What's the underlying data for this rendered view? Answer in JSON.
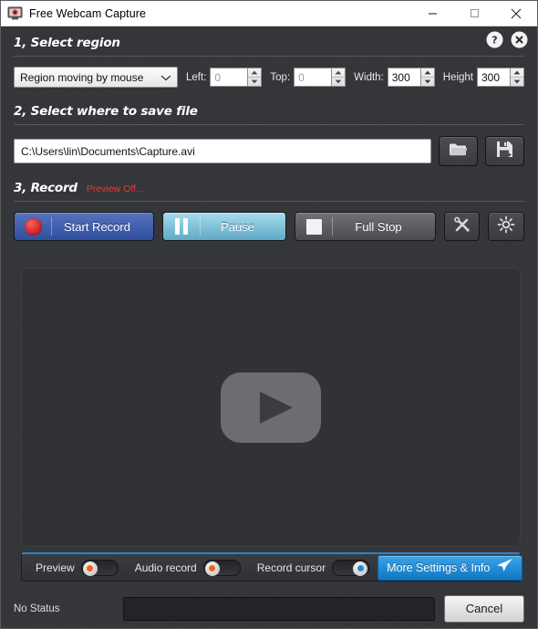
{
  "window": {
    "title": "Free Webcam Capture",
    "app_icon": "webcam-icon",
    "minimize_label": "—",
    "maximize_label": "□",
    "close_label": "✕"
  },
  "header_icons": {
    "help": "help-circle-icon",
    "close": "close-circle-icon"
  },
  "section1": {
    "title": "1, Select region",
    "region_mode": "Region moving by mouse",
    "fields": [
      {
        "label": "Left:",
        "value": "0",
        "disabled": true
      },
      {
        "label": "Top:",
        "value": "0",
        "disabled": true
      },
      {
        "label": "Width:",
        "value": "300",
        "disabled": false
      },
      {
        "label": "Height",
        "value": "300",
        "disabled": false
      }
    ]
  },
  "section2": {
    "title": "2, Select where to save file",
    "path": "C:\\Users\\lin\\Documents\\Capture.avi",
    "browse_icon": "folder-open-icon",
    "save_icon": "save-disk-icon"
  },
  "section3": {
    "title": "3, Record",
    "preview_status": "Preview Off...",
    "buttons": {
      "start": "Start Record",
      "pause": "Pause",
      "stop": "Full Stop"
    },
    "tools_icon": "tools-wrench-icon",
    "brightness_icon": "brightness-sun-icon"
  },
  "preview": {
    "play_icon": "play-button-icon"
  },
  "toggles": [
    {
      "label": "Preview",
      "state": "off",
      "knob_color": "#f4601e"
    },
    {
      "label": "Audio record",
      "state": "off",
      "knob_color": "#f4601e"
    },
    {
      "label": "Record cursor",
      "state": "on",
      "knob_color": "#1f8ad6"
    }
  ],
  "more_settings": {
    "label": "More Settings & Info",
    "icon": "send-plane-icon"
  },
  "status": {
    "text": "No Status",
    "progress_value": 0,
    "cancel_label": "Cancel"
  },
  "colors": {
    "accent_blue": "#2a84cf",
    "record_red": "#c91f1f",
    "warning_red": "#e03b3b",
    "background": "#34363a"
  }
}
